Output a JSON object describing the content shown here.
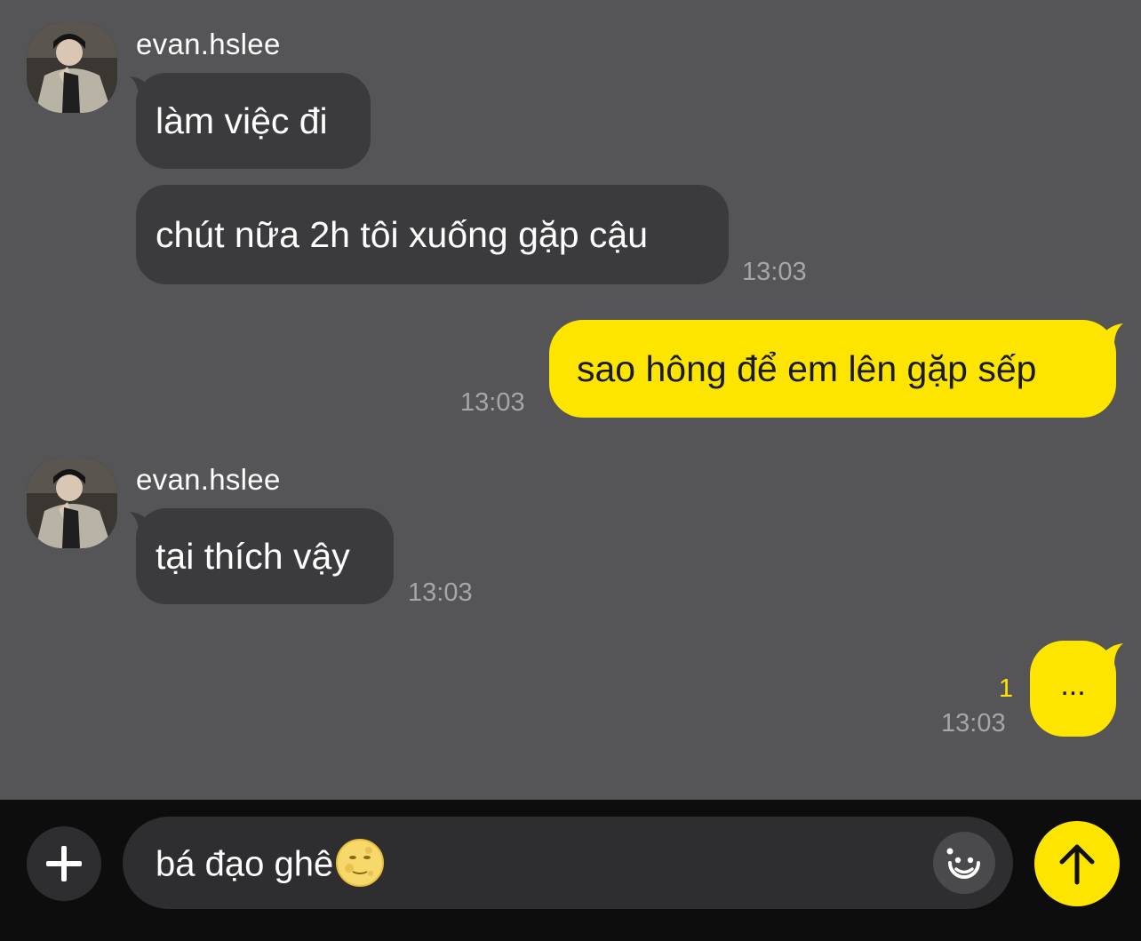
{
  "messages": [
    {
      "sender": "evan.hslee",
      "text": "làm việc đi"
    },
    {
      "text": "chút nữa 2h tôi xuống gặp cậu",
      "time": "13:03"
    },
    {
      "text": "sao hông để em lên gặp sếp",
      "time": "13:03"
    },
    {
      "sender": "evan.hslee",
      "text": "tại thích vậy",
      "time": "13:03"
    },
    {
      "text": "...",
      "time": "13:03",
      "unread": "1"
    }
  ],
  "input": {
    "value": "bá đạo ghê",
    "emoji": "moon-face-emoji"
  },
  "icons": {
    "attach": "plus-icon",
    "emoticon": "smiley-icon",
    "send": "arrow-up-icon"
  },
  "colors": {
    "chat_background": "#555456",
    "incoming_bubble": "#3b3a3d",
    "outgoing_bubble": "#fee500",
    "input_bar": "#0d0d0d",
    "timestamp": "#a7a5a8"
  }
}
